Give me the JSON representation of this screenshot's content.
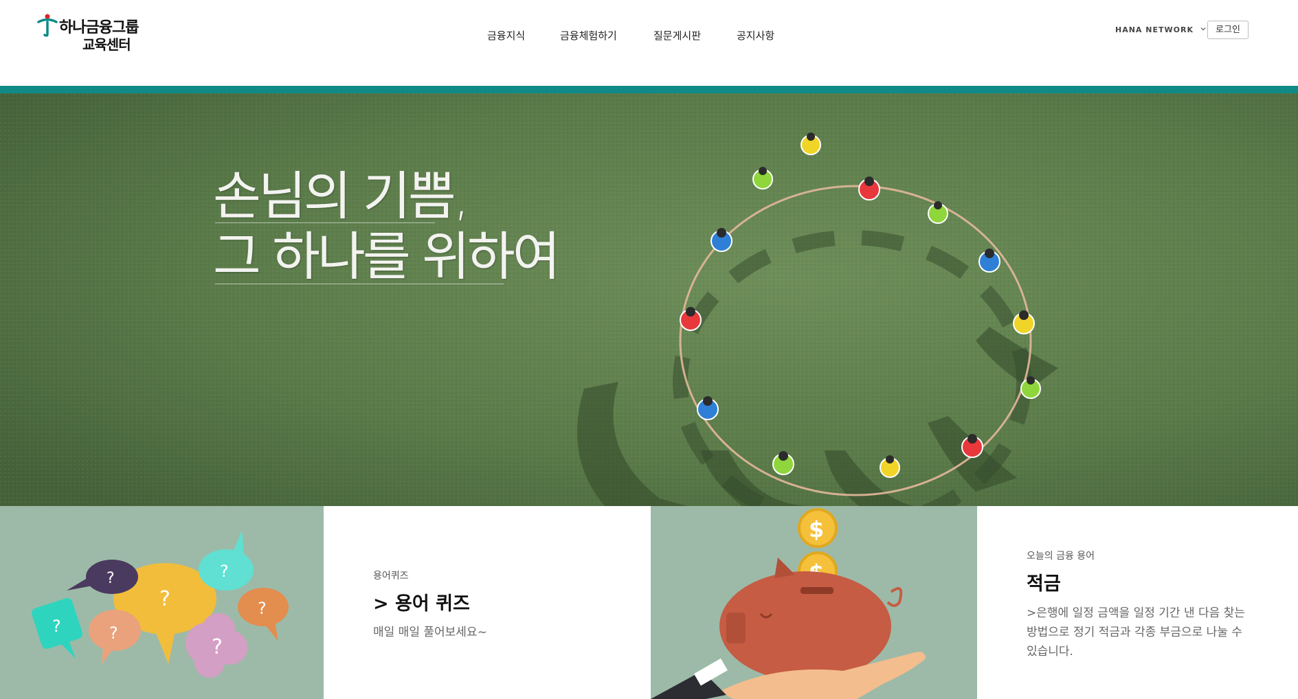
{
  "header": {
    "logo": {
      "line1": "하나금융그룹",
      "line2": "교육센터"
    },
    "nav": [
      {
        "label": "금융지식"
      },
      {
        "label": "금융체험하기"
      },
      {
        "label": "질문게시판"
      },
      {
        "label": "공지사항"
      }
    ],
    "network_label": "HANA NETWORK",
    "login_label": "로그인"
  },
  "hero": {
    "line1": "손님의 기쁨,",
    "line2": "그 하나를 위하여"
  },
  "cards": {
    "quiz": {
      "kicker": "용어퀴즈",
      "title": "> 용어 퀴즈",
      "desc": "매일 매일 풀어보세요~"
    },
    "term": {
      "kicker": "오늘의 금융 용어",
      "title": "적금",
      "desc": ">은행에 일정 금액을 일정 기간 낸 다음 찾는 방법으로 정기 적금과 각종 부금으로 나눌 수 있습니다."
    }
  },
  "colors": {
    "brand_teal": "#0f8a86",
    "card_sage": "#9dbaa8",
    "grass": "#5d7c4c"
  }
}
